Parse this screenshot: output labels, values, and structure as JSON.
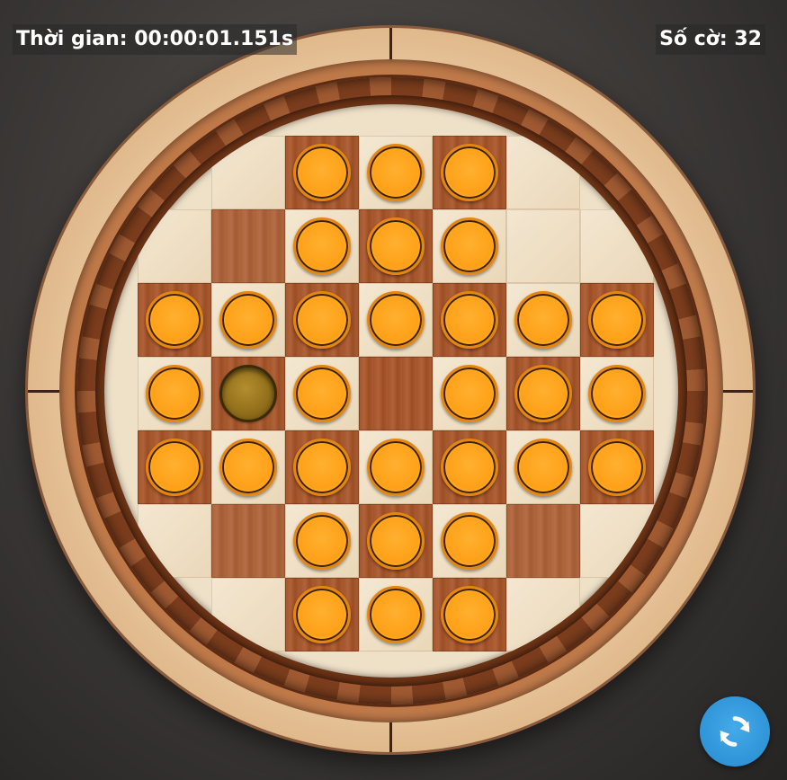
{
  "hud": {
    "timer_text": "Thời gian: 00:00:01.151s",
    "count_text": "Số cờ: 32"
  },
  "board": {
    "rows": 7,
    "cols": 7,
    "cells": [
      [
        "void",
        "void",
        "dark",
        "light",
        "dark",
        "void",
        "void"
      ],
      [
        "void",
        "void",
        "light",
        "dark",
        "light",
        "void",
        "void"
      ],
      [
        "dark",
        "light",
        "dark",
        "light",
        "dark",
        "light",
        "dark"
      ],
      [
        "light",
        "dark",
        "light",
        "dark",
        "light",
        "dark",
        "light"
      ],
      [
        "dark",
        "light",
        "dark",
        "light",
        "dark",
        "light",
        "dark"
      ],
      [
        "void",
        "void",
        "light",
        "dark",
        "light",
        "void",
        "void"
      ],
      [
        "void",
        "void",
        "dark",
        "light",
        "dark",
        "void",
        "void"
      ]
    ],
    "pegs": [
      [
        "empty",
        "empty",
        "peg",
        "peg",
        "peg",
        "empty",
        "empty"
      ],
      [
        "empty",
        "empty",
        "peg",
        "peg",
        "peg",
        "empty",
        "empty"
      ],
      [
        "peg",
        "peg",
        "peg",
        "peg",
        "peg",
        "peg",
        "peg"
      ],
      [
        "peg",
        "selected",
        "peg",
        "empty",
        "peg",
        "peg",
        "peg"
      ],
      [
        "peg",
        "peg",
        "peg",
        "peg",
        "peg",
        "peg",
        "peg"
      ],
      [
        "empty",
        "empty",
        "peg",
        "peg",
        "peg",
        "empty",
        "empty"
      ],
      [
        "empty",
        "empty",
        "peg",
        "peg",
        "peg",
        "empty",
        "empty"
      ]
    ]
  },
  "colors": {
    "peg": "#ffa21a",
    "peg_selected": "#93701c",
    "reset_button": "#2f94d8"
  },
  "icons": {
    "reset": "refresh-icon"
  }
}
